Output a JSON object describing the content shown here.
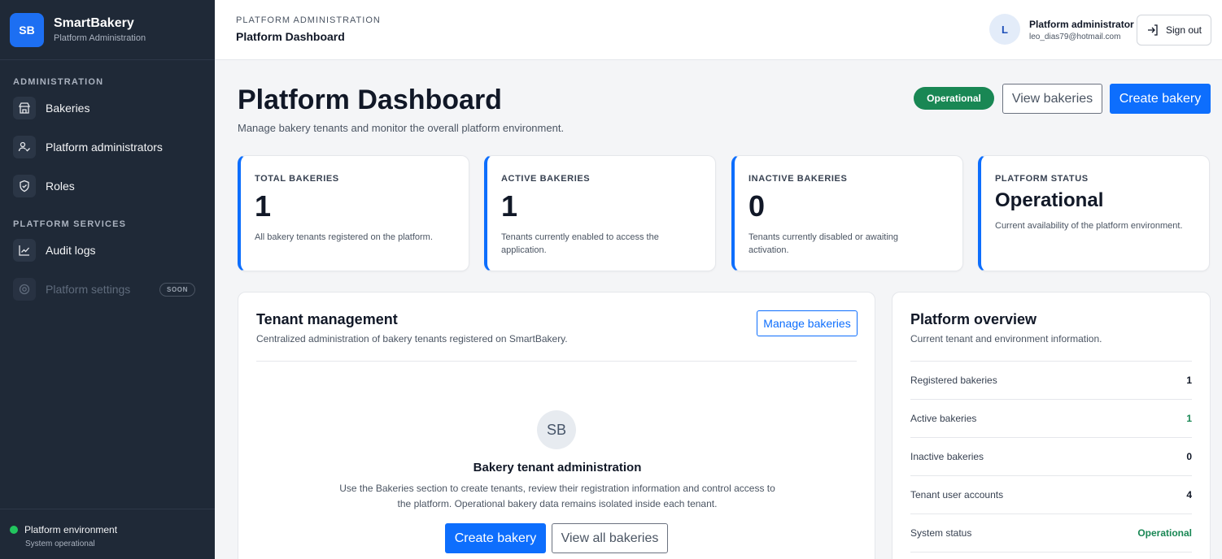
{
  "brand": {
    "logo": "SB",
    "name": "SmartBakery",
    "subtitle": "Platform Administration"
  },
  "sidebar": {
    "section_admin": "ADMINISTRATION",
    "admin_items": [
      {
        "label": "Bakeries",
        "icon": "store-icon"
      },
      {
        "label": "Platform administrators",
        "icon": "user-check-icon"
      },
      {
        "label": "Roles",
        "icon": "shield-icon"
      }
    ],
    "section_services": "PLATFORM SERVICES",
    "service_items": [
      {
        "label": "Audit logs",
        "icon": "chart-line-icon"
      },
      {
        "label": "Platform settings",
        "icon": "settings-icon",
        "badge": "SOON",
        "disabled": true
      }
    ],
    "footer": {
      "title": "Platform environment",
      "status": "System operational",
      "status_color": "#22c55e"
    }
  },
  "topbar": {
    "breadcrumb": "PLATFORM ADMINISTRATION",
    "title": "Platform Dashboard",
    "user": {
      "initial": "L",
      "role": "Platform administrator",
      "email": "leo_dias79@hotmail.com"
    },
    "signout_label": "Sign out"
  },
  "header": {
    "title": "Platform Dashboard",
    "description": "Manage bakery tenants and monitor the overall platform environment.",
    "status_badge": "Operational",
    "view_button": "View bakeries",
    "create_button": "Create bakery"
  },
  "stats": [
    {
      "label": "TOTAL BAKERIES",
      "value": "1",
      "note": "All bakery tenants registered on the platform."
    },
    {
      "label": "ACTIVE BAKERIES",
      "value": "1",
      "note": "Tenants currently enabled to access the application."
    },
    {
      "label": "INACTIVE BAKERIES",
      "value": "0",
      "note": "Tenants currently disabled or awaiting activation."
    },
    {
      "label": "PLATFORM STATUS",
      "value": "Operational",
      "note": "Current availability of the platform environment."
    }
  ],
  "tenant": {
    "title": "Tenant management",
    "subtitle": "Centralized administration of bakery tenants registered on SmartBakery.",
    "manage_button": "Manage bakeries",
    "empty_avatar": "SB",
    "empty_title": "Bakery tenant administration",
    "empty_text": "Use the Bakeries section to create tenants, review their registration information and control access to the platform. Operational bakery data remains isolated inside each tenant.",
    "create_button": "Create bakery",
    "view_all_button": "View all bakeries"
  },
  "overview": {
    "title": "Platform overview",
    "subtitle": "Current tenant and environment information.",
    "rows": [
      {
        "label": "Registered bakeries",
        "value": "1"
      },
      {
        "label": "Active bakeries",
        "value": "1",
        "highlight": true
      },
      {
        "label": "Inactive bakeries",
        "value": "0"
      },
      {
        "label": "Tenant user accounts",
        "value": "4"
      },
      {
        "label": "System status",
        "value": "Operational",
        "highlight": true
      }
    ]
  },
  "colors": {
    "primary": "#0d6efd",
    "success": "#198754",
    "sidebar": "#1f2937"
  }
}
